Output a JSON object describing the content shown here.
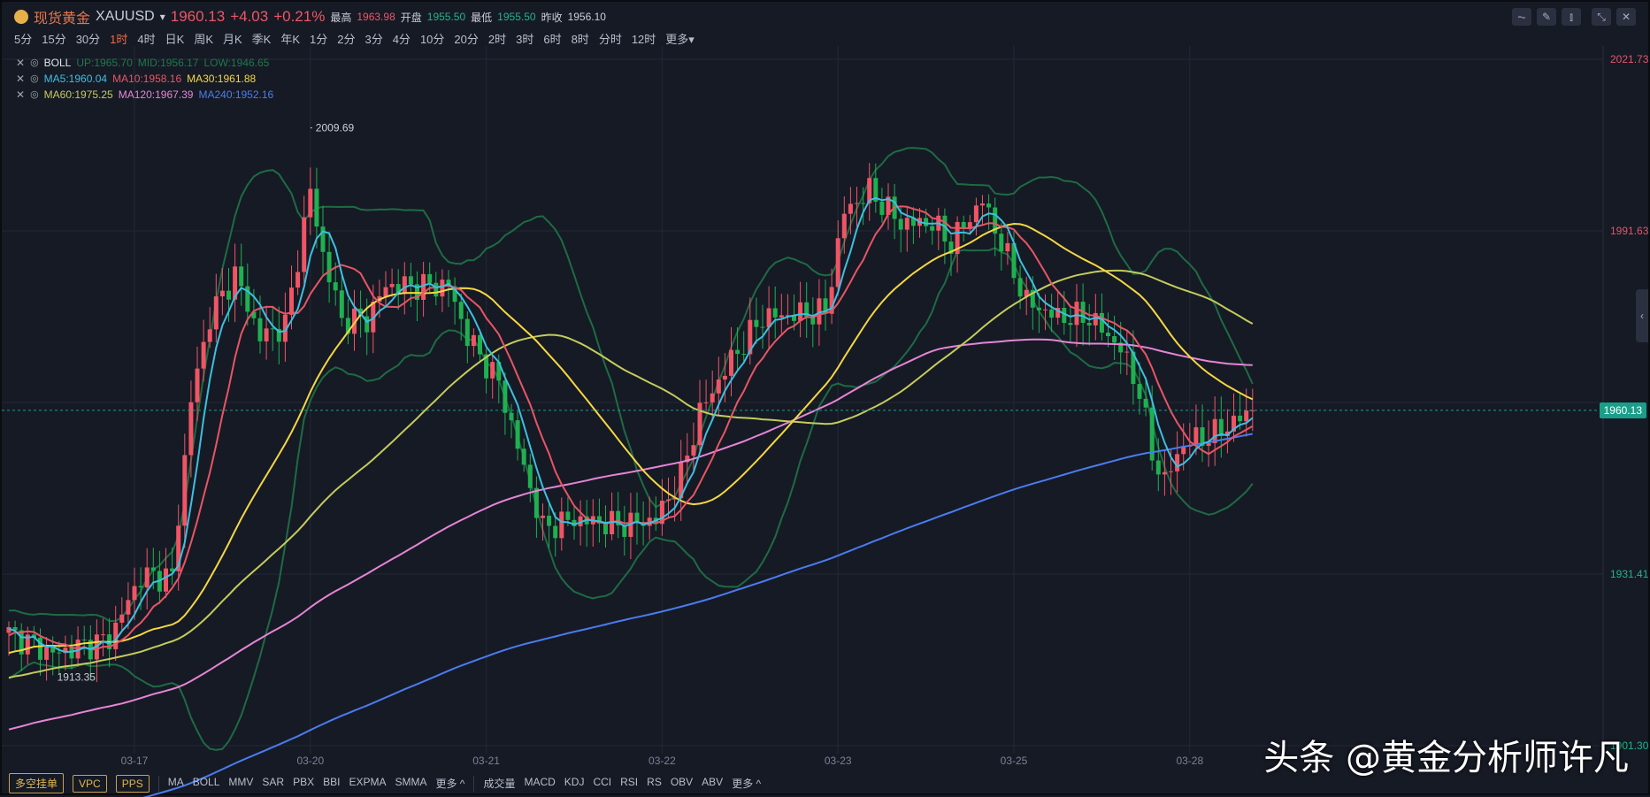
{
  "header": {
    "title": "现货黄金",
    "symbol": "XAUUSD",
    "price": "1960.13",
    "change": "+4.03",
    "change_pct": "+0.21%",
    "high_label": "最高",
    "high": "1963.98",
    "open_label": "开盘",
    "open": "1955.50",
    "low_label": "最低",
    "low": "1955.50",
    "prev_label": "昨收",
    "prev": "1956.10"
  },
  "periods": [
    "5分",
    "15分",
    "30分",
    "1时",
    "4时",
    "日K",
    "周K",
    "月K",
    "季K",
    "年K",
    "1分",
    "2分",
    "3分",
    "4分",
    "10分",
    "20分",
    "2时",
    "3时",
    "6时",
    "8时",
    "分时",
    "12时",
    "更多▾"
  ],
  "active_period": "1时",
  "legend": {
    "boll": {
      "name": "BOLL",
      "up": "UP:1965.70",
      "mid": "MID:1956.17",
      "low": "LOW:1946.65"
    },
    "ma1": {
      "ma5": "MA5:1960.04",
      "ma10": "MA10:1958.16",
      "ma30": "MA30:1961.88"
    },
    "ma2": {
      "ma60": "MA60:1975.25",
      "ma120": "MA120:1967.39",
      "ma240": "MA240:1952.16"
    }
  },
  "colors": {
    "up": "#ef5565",
    "down": "#1fb050",
    "boll": "#1d6b44",
    "ma5": "#3cc0e0",
    "ma10": "#e85565",
    "ma30": "#f5d742",
    "ma60": "#c4cc5c",
    "ma120": "#e685d6",
    "ma240": "#4a7cf0"
  },
  "chart_data": {
    "type": "candlestick",
    "y_ticks": [
      "2021.73",
      "1991.63",
      "1931.41",
      "1901.30"
    ],
    "ylim": [
      1901.3,
      2021.73
    ],
    "current_price": "1960.13",
    "annotations": {
      "max": "2009.69",
      "min": "1913.35"
    },
    "x_ticks": [
      "03-17",
      "03-20",
      "03-21",
      "03-22",
      "03-23",
      "03-25",
      "03-28"
    ],
    "x_tick_bars": [
      20,
      48,
      76,
      104,
      132,
      160,
      188
    ],
    "close_waypoints": [
      [
        0,
        1921
      ],
      [
        7,
        1917.4
      ],
      [
        16,
        1920
      ],
      [
        21,
        1931
      ],
      [
        26,
        1931
      ],
      [
        29,
        1962
      ],
      [
        32,
        1976.5
      ],
      [
        36,
        1984
      ],
      [
        40,
        1973
      ],
      [
        44,
        1975
      ],
      [
        48,
        1998.6
      ],
      [
        50,
        1987.5
      ],
      [
        53,
        1976
      ],
      [
        57,
        1976
      ],
      [
        60,
        1982
      ],
      [
        70,
        1982
      ],
      [
        73,
        1973
      ],
      [
        78,
        1965
      ],
      [
        82,
        1950
      ],
      [
        85,
        1939.5
      ],
      [
        90,
        1941
      ],
      [
        97,
        1940
      ],
      [
        103,
        1941
      ],
      [
        107,
        1948.6
      ],
      [
        110,
        1959.8
      ],
      [
        115,
        1969
      ],
      [
        120,
        1976.5
      ],
      [
        130,
        1977.4
      ],
      [
        133,
        1995
      ],
      [
        137,
        1998.6
      ],
      [
        142,
        1993
      ],
      [
        147,
        1993
      ],
      [
        150,
        1989.4
      ],
      [
        155,
        1997
      ],
      [
        158,
        1989.4
      ],
      [
        162,
        1979.2
      ],
      [
        167,
        1976.5
      ],
      [
        172,
        1976.5
      ],
      [
        177,
        1971
      ],
      [
        180,
        1963.5
      ],
      [
        182,
        1952.4
      ],
      [
        184,
        1947.8
      ],
      [
        187,
        1954.3
      ],
      [
        192,
        1956
      ],
      [
        198,
        1960.1
      ]
    ]
  },
  "toolbar": {
    "buttons": [
      "多空挂单",
      "VPC",
      "PPS"
    ],
    "main_ind": [
      "MA",
      "BOLL",
      "MMV",
      "SAR",
      "PBX",
      "BBI",
      "EXPMA",
      "SMMA",
      "更多 ^"
    ],
    "sub_ind": [
      "成交量",
      "MACD",
      "KDJ",
      "CCI",
      "RSI",
      "RS",
      "OBV",
      "ABV",
      "更多 ^"
    ]
  },
  "watermark": "头条 @黄金分析师许凡"
}
